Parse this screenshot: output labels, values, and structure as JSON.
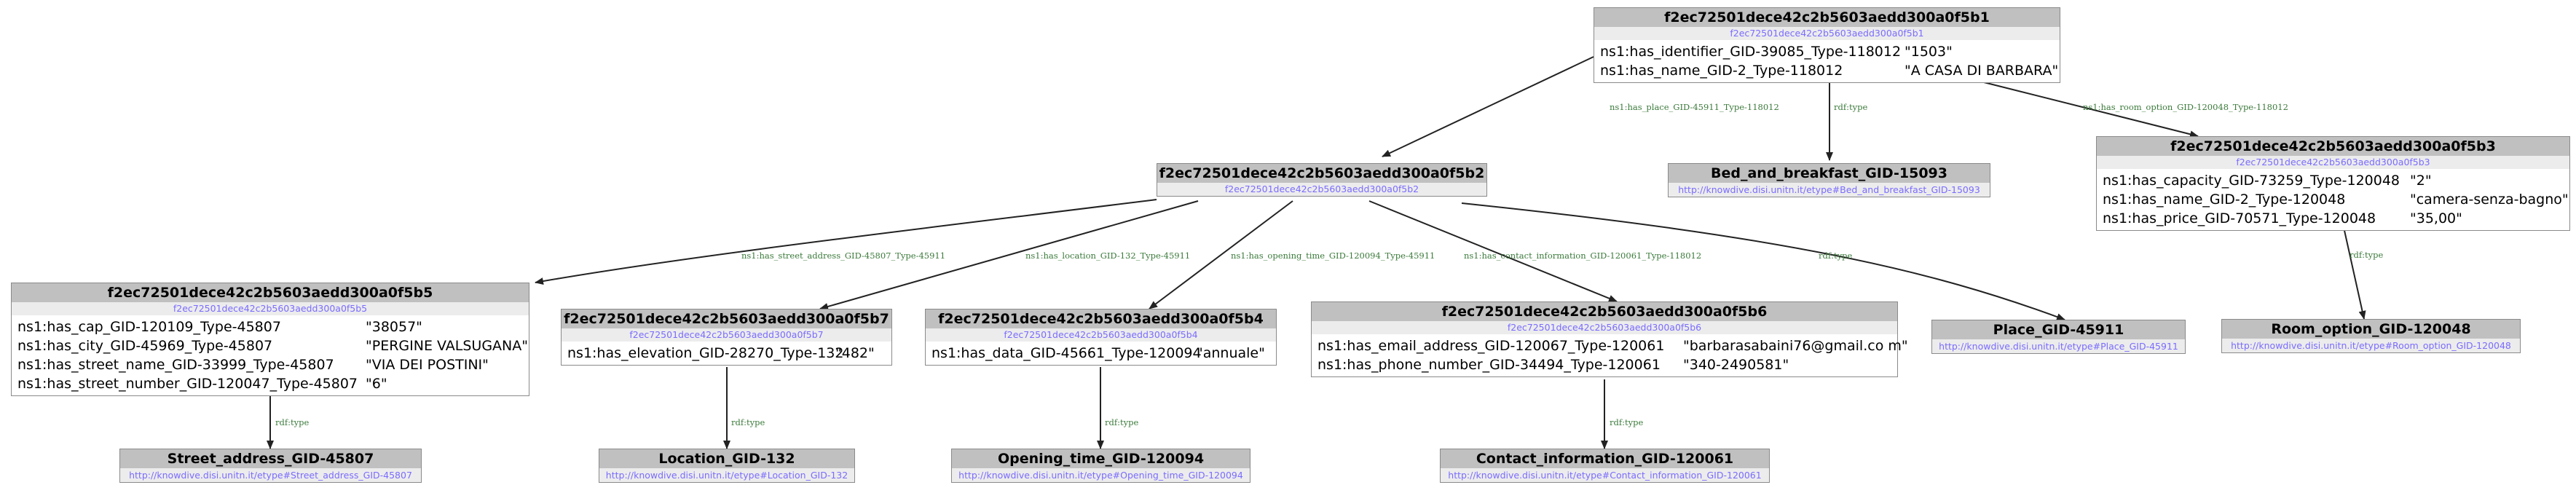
{
  "nodes": {
    "b1": {
      "title": "f2ec72501dece42c2b5603aedd300a0f5b1",
      "uri": "f2ec72501dece42c2b5603aedd300a0f5b1",
      "props": [
        {
          "p": "ns1:has_identifier_GID-39085_Type-118012",
          "v": "\"1503\""
        },
        {
          "p": "ns1:has_name_GID-2_Type-118012",
          "v": "\"A CASA DI BARBARA\""
        }
      ]
    },
    "b2": {
      "title": "f2ec72501dece42c2b5603aedd300a0f5b2",
      "uri": "f2ec72501dece42c2b5603aedd300a0f5b2",
      "props": []
    },
    "b3": {
      "title": "f2ec72501dece42c2b5603aedd300a0f5b3",
      "uri": "f2ec72501dece42c2b5603aedd300a0f5b3",
      "props": [
        {
          "p": "ns1:has_capacity_GID-73259_Type-120048",
          "v": "\"2\""
        },
        {
          "p": "ns1:has_name_GID-2_Type-120048",
          "v": "\"camera-senza-bagno\""
        },
        {
          "p": "ns1:has_price_GID-70571_Type-120048",
          "v": "\"35,00\""
        }
      ]
    },
    "b4": {
      "title": "f2ec72501dece42c2b5603aedd300a0f5b4",
      "uri": "f2ec72501dece42c2b5603aedd300a0f5b4",
      "props": [
        {
          "p": "ns1:has_data_GID-45661_Type-120094",
          "v": "\"annuale\""
        }
      ]
    },
    "b5": {
      "title": "f2ec72501dece42c2b5603aedd300a0f5b5",
      "uri": "f2ec72501dece42c2b5603aedd300a0f5b5",
      "props": [
        {
          "p": "ns1:has_cap_GID-120109_Type-45807",
          "v": "\"38057\""
        },
        {
          "p": "ns1:has_city_GID-45969_Type-45807",
          "v": "\"PERGINE VALSUGANA\""
        },
        {
          "p": "ns1:has_street_name_GID-33999_Type-45807",
          "v": "\"VIA DEI POSTINI\""
        },
        {
          "p": "ns1:has_street_number_GID-120047_Type-45807",
          "v": "\"6\""
        }
      ]
    },
    "b6": {
      "title": "f2ec72501dece42c2b5603aedd300a0f5b6",
      "uri": "f2ec72501dece42c2b5603aedd300a0f5b6",
      "props": [
        {
          "p": "ns1:has_email_address_GID-120067_Type-120061",
          "v": "\"barbarasabaini76@gmail.co m\""
        },
        {
          "p": "ns1:has_phone_number_GID-34494_Type-120061",
          "v": "\"340-2490581\""
        }
      ]
    },
    "b7": {
      "title": "f2ec72501dece42c2b5603aedd300a0f5b7",
      "uri": "f2ec72501dece42c2b5603aedd300a0f5b7",
      "props": [
        {
          "p": "ns1:has_elevation_GID-28270_Type-132",
          "v": "\"482\""
        }
      ]
    }
  },
  "types": {
    "bnb": {
      "title": "Bed_and_breakfast_GID-15093",
      "uri": "http://knowdive.disi.unitn.it/etype#Bed_and_breakfast_GID-15093"
    },
    "place": {
      "title": "Place_GID-45911",
      "uri": "http://knowdive.disi.unitn.it/etype#Place_GID-45911"
    },
    "room": {
      "title": "Room_option_GID-120048",
      "uri": "http://knowdive.disi.unitn.it/etype#Room_option_GID-120048"
    },
    "street": {
      "title": "Street_address_GID-45807",
      "uri": "http://knowdive.disi.unitn.it/etype#Street_address_GID-45807"
    },
    "location": {
      "title": "Location_GID-132",
      "uri": "http://knowdive.disi.unitn.it/etype#Location_GID-132"
    },
    "opening": {
      "title": "Opening_time_GID-120094",
      "uri": "http://knowdive.disi.unitn.it/etype#Opening_time_GID-120094"
    },
    "contact": {
      "title": "Contact_information_GID-120061",
      "uri": "http://knowdive.disi.unitn.it/etype#Contact_information_GID-120061"
    }
  },
  "edges": [
    {
      "id": "e1",
      "label": "ns1:has_place_GID-45911_Type-118012"
    },
    {
      "id": "e2",
      "label": "rdf:type"
    },
    {
      "id": "e3",
      "label": "ns1:has_room_option_GID-120048_Type-118012"
    },
    {
      "id": "e4",
      "label": "ns1:has_street_address_GID-45807_Type-45911"
    },
    {
      "id": "e5",
      "label": "ns1:has_location_GID-132_Type-45911"
    },
    {
      "id": "e6",
      "label": "ns1:has_opening_time_GID-120094_Type-45911"
    },
    {
      "id": "e7",
      "label": "ns1:has_contact_information_GID-120061_Type-118012"
    },
    {
      "id": "e8",
      "label": "rdf:type"
    },
    {
      "id": "e9",
      "label": "rdf:type"
    },
    {
      "id": "e10",
      "label": "rdf:type"
    },
    {
      "id": "e11",
      "label": "rdf:type"
    },
    {
      "id": "e12",
      "label": "rdf:type"
    },
    {
      "id": "e13",
      "label": "rdf:type"
    }
  ],
  "colors": {
    "header": "#c0c0c0",
    "uri_text": "#7a6cff",
    "edge_label": "#3b7a3b",
    "edge": "#222222"
  }
}
